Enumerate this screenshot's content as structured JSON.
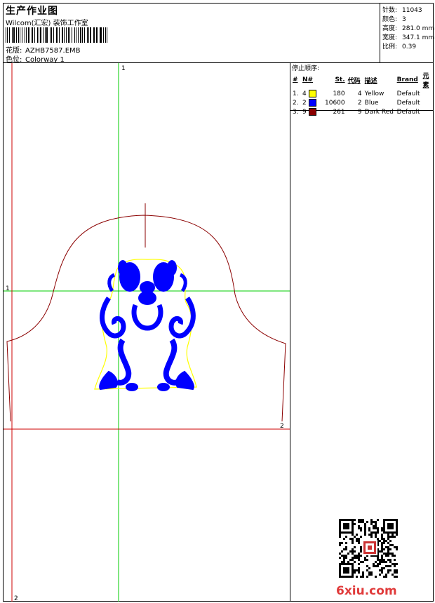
{
  "header": {
    "title": "生产作业图",
    "studio": "Wilcom(汇宏) 装饰工作室",
    "design_label": "花版:",
    "design_value": "AZHB7587.EMB",
    "colorway_label": "色位:",
    "colorway_value": "Colorway 1"
  },
  "stats": [
    {
      "label": "针数:",
      "value": "11043"
    },
    {
      "label": "颜色:",
      "value": "3"
    },
    {
      "label": "高度:",
      "value": "281.0 mm"
    },
    {
      "label": "宽度:",
      "value": "347.1 mm"
    },
    {
      "label": "比例:",
      "value": "0.39"
    }
  ],
  "stop_sequence": {
    "title": "停止顺序:",
    "columns": [
      "#",
      "N#",
      "St.",
      "代码",
      "描述",
      "Brand",
      "元素"
    ],
    "rows": [
      {
        "seq": "1.",
        "n": "4",
        "color": "#ffff00",
        "st": "180",
        "code": "4",
        "desc": "Yellow",
        "brand": "Default"
      },
      {
        "seq": "2.",
        "n": "2",
        "color": "#0000ff",
        "st": "10600",
        "code": "2",
        "desc": "Blue",
        "brand": "Default"
      },
      {
        "seq": "3.",
        "n": "9",
        "color": "#8b0000",
        "st": "261",
        "code": "9",
        "desc": "Dark Red",
        "brand": "Default"
      }
    ]
  },
  "guides": {
    "green_v": "1",
    "green_h": "1",
    "red_v": "2",
    "red_h": "2"
  },
  "colors": {
    "guide_green": "#00cc00",
    "guide_red": "#cc0000",
    "outline": "#8b0000",
    "embroidery": "#0000ff",
    "border": "#ffff00"
  },
  "watermark": {
    "brand": "6xiu.com"
  }
}
